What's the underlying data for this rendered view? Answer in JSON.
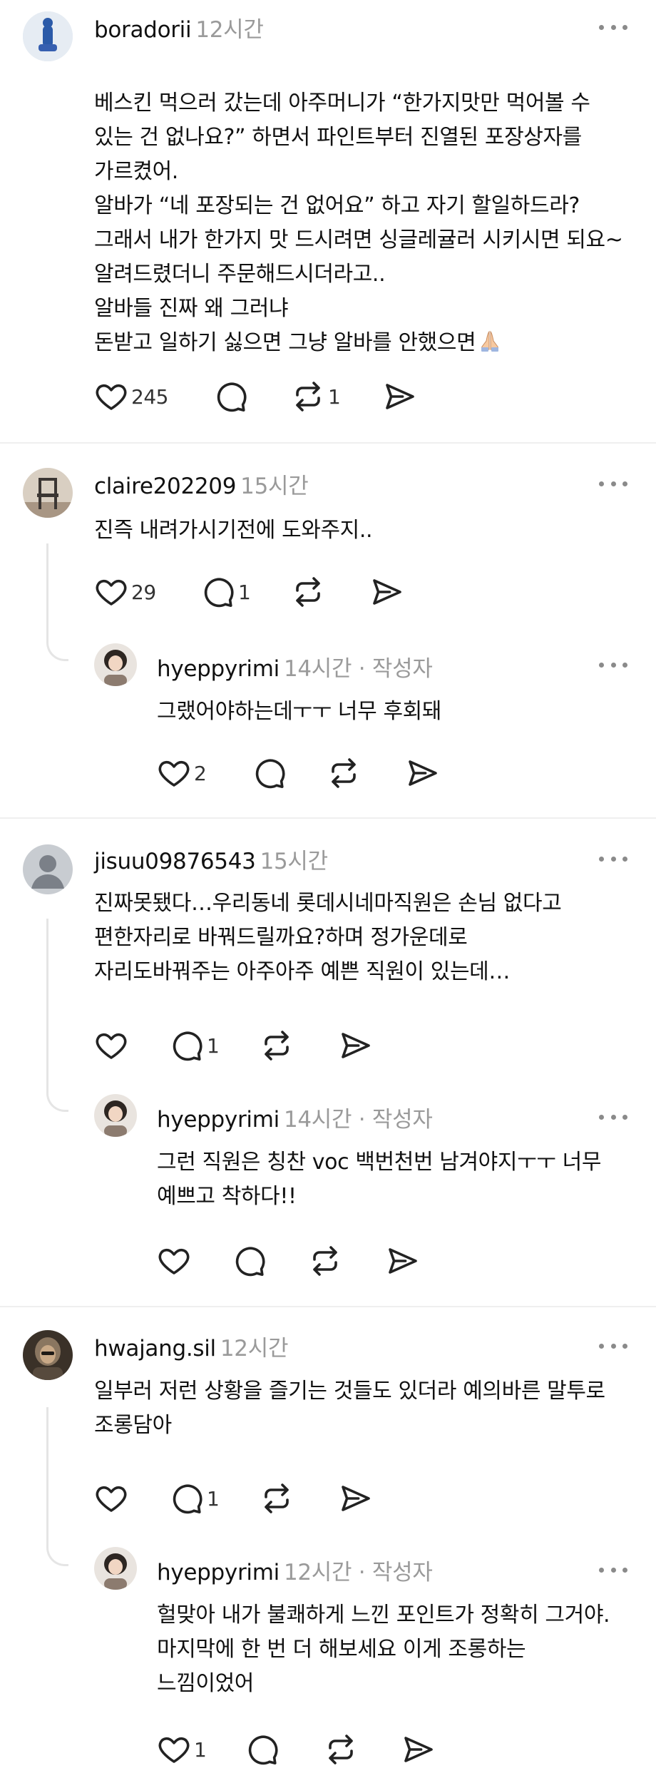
{
  "comments": [
    {
      "username": "boradorii",
      "time": "12시간",
      "text": "베스킨 먹으러 갔는데 아주머니가 “한가지맛만 먹어볼 수\n있는 건 없나요?” 하면서 파인트부터 진열된 포장상자를\n가르켰어.\n알바가 “네 포장되는 건 없어요” 하고 자기 할일하드라?\n그래서 내가 한가지 맛 드시려면 싱글레귤러 시키시면 되요~\n알려드렸더니 주문해드시더라고..\n알바들 진짜 왜 그러냐\n돈받고 일하기 싫으면 그냥 알바를 안했으면",
      "emoji": "folded-hands-emoji",
      "likes": "245",
      "replies": "",
      "reposts": "1"
    },
    {
      "username": "claire202209",
      "time": "15시간",
      "text": "진즉 내려가시기전에 도와주지..",
      "likes": "29",
      "replies": "1",
      "reposts": "",
      "reply": {
        "username": "hyeppyrimi",
        "time": "14시간 · 작성자",
        "text": "그랬어야하는데ㅜㅜ 너무 후회돼",
        "likes": "2",
        "replies": "",
        "reposts": ""
      }
    },
    {
      "username": "jisuu09876543",
      "time": "15시간",
      "text": "진짜못됐다…우리동네 롯데시네마직원은 손님 없다고\n편한자리로 바꿔드릴까요?하며 정가운데로\n자리도바꿔주는 아주아주 예쁜 직원이 있는데…",
      "likes": "",
      "replies": "1",
      "reposts": "",
      "reply": {
        "username": "hyeppyrimi",
        "time": "14시간 · 작성자",
        "text": "그런 직원은 칭찬 voc 백번천번 남겨야지ㅜㅜ 너무\n예쁘고 착하다!!",
        "likes": "",
        "replies": "",
        "reposts": ""
      }
    },
    {
      "username": "hwajang.sil",
      "time": "12시간",
      "text": "일부러 저런 상황을 즐기는 것들도 있더라 예의바른 말투로\n조롱담아",
      "likes": "",
      "replies": "1",
      "reposts": "",
      "reply": {
        "username": "hyeppyrimi",
        "time": "12시간 · 작성자",
        "text": "헐맞아 내가 불쾌하게 느낀 포인트가 정확히 그거야.\n마지막에 한 번 더 해보세요 이게 조롱하는\n느낌이었어",
        "likes": "1",
        "replies": "",
        "reposts": ""
      }
    }
  ]
}
